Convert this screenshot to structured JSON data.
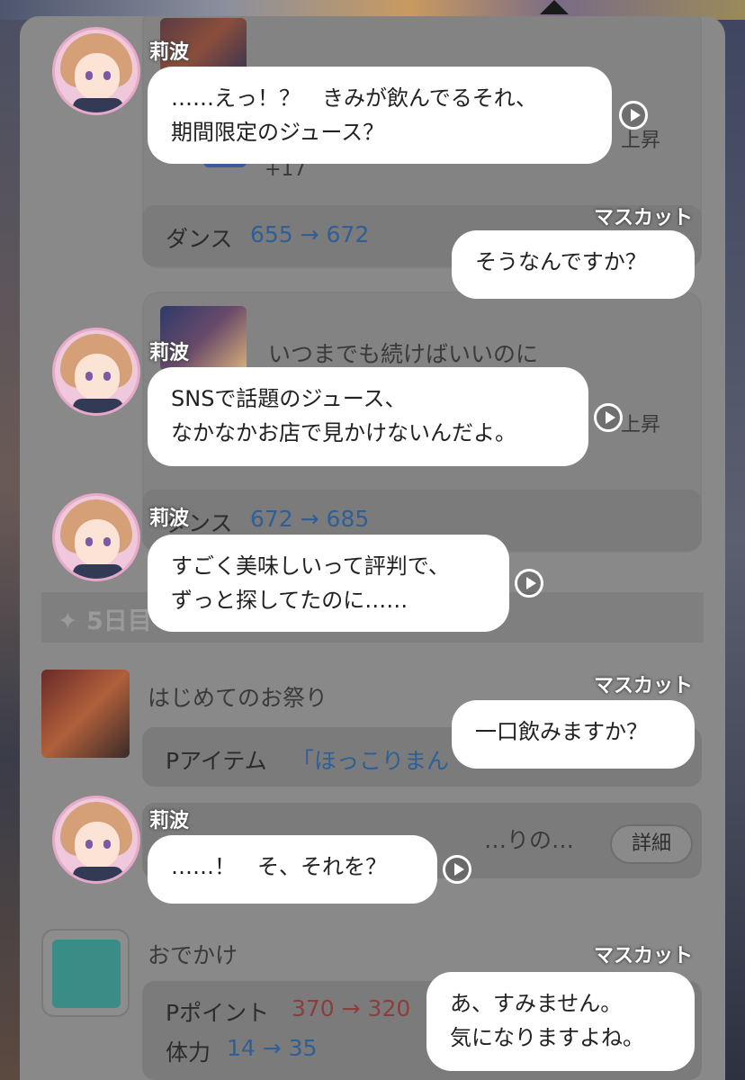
{
  "background_log": {
    "entries": [
      {
        "partial_title": "…",
        "extra_count": "+17",
        "rise_label": "上昇",
        "stat_label": "ダンス",
        "stat_value": "655 → 672"
      },
      {
        "title": "いつまでも続けばいいのに",
        "rise_label": "上昇",
        "stat_label": "ダンス",
        "stat_value": "672 → 685"
      }
    ],
    "day_header": "✦ 5日目",
    "festival": {
      "title": "はじめてのお祭り",
      "item_label": "Pアイテム",
      "item_value": "「ほっこりまん"
    },
    "partial_item": {
      "title": "…りの…",
      "detail_button": "詳細"
    },
    "outing": {
      "title": "おでかけ",
      "points_label": "Pポイント",
      "points_value": "370 → 320",
      "stamina_label": "体力",
      "stamina_value": "14 → 35"
    }
  },
  "chat": [
    {
      "speaker": "莉波",
      "side": "left",
      "line1": "……えっ！？　きみが飲んでるそれ、",
      "line2": "期間限定のジュース？"
    },
    {
      "speaker": "マスカット",
      "side": "right",
      "line1": "そうなんですか？"
    },
    {
      "speaker": "莉波",
      "side": "left",
      "line1": "SNSで話題のジュース、",
      "line2": "なかなかお店で見かけないんだよ。"
    },
    {
      "speaker": "莉波",
      "side": "left",
      "line1": "すごく美味しいって評判で、",
      "line2": "ずっと探してたのに……"
    },
    {
      "speaker": "マスカット",
      "side": "right",
      "line1": "一口飲みますか？"
    },
    {
      "speaker": "莉波",
      "side": "left",
      "line1": "……！　そ、それを？"
    },
    {
      "speaker": "マスカット",
      "side": "right",
      "line1": "あ、すみません。",
      "line2": "気になりますよね。"
    }
  ]
}
